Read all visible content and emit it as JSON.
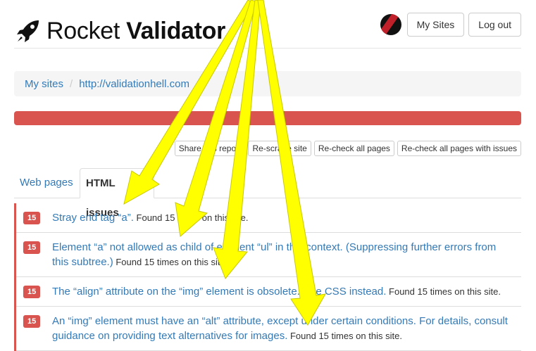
{
  "header": {
    "brand_light": "Rocket ",
    "brand_bold": "Validator",
    "my_sites_label": "My Sites",
    "logout_label": "Log out"
  },
  "breadcrumb": {
    "items": [
      "My sites",
      "http://validationhell.com"
    ],
    "separator": "/"
  },
  "progress": {
    "value_percent": 100,
    "color": "#d9534f"
  },
  "actions": {
    "share": "Share this report",
    "rescrape": "Re-scrape site",
    "recheck_all": "Re-check all pages",
    "recheck_issues": "Re-check all pages with issues"
  },
  "tabs": [
    {
      "label": "Web pages",
      "active": false
    },
    {
      "label": "HTML issues",
      "active": true
    }
  ],
  "issues": [
    {
      "count": "15",
      "message": "Stray end tag “a”.",
      "found": " Found 15 times on this site."
    },
    {
      "count": "15",
      "message": "Element “a” not allowed as child of element “ul” in this context. (Suppressing further errors from this subtree.)",
      "found": " Found 15 times on this site."
    },
    {
      "count": "15",
      "message": "The “align” attribute on the “img” element is obsolete. Use CSS instead.",
      "found": " Found 15 times on this site."
    },
    {
      "count": "15",
      "message": "An “img” element must have an “alt” attribute, except under certain conditions. For details, consult guidance on providing text alternatives for images.",
      "found": " Found 15 times on this site."
    }
  ],
  "colors": {
    "accent": "#337ab7",
    "danger": "#d9534f",
    "arrow": "#ffff00"
  },
  "icons": {
    "logo": "rocket-icon",
    "avatar": "user-avatar"
  }
}
